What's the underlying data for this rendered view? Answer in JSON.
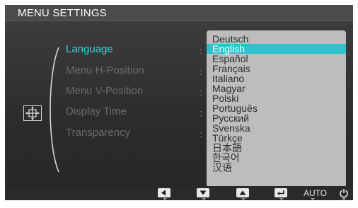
{
  "header": {
    "title": "MENU SETTINGS"
  },
  "menu": {
    "items": [
      {
        "label": "Language"
      },
      {
        "label": "Menu H-Position"
      },
      {
        "label": "Menu V-Position"
      },
      {
        "label": "Display Time"
      },
      {
        "label": "Transparency"
      }
    ],
    "active_index": 0,
    "separator": ":"
  },
  "dropdown": {
    "options": [
      "Deutsch",
      "English",
      "Español",
      "Français",
      "Italiano",
      "Magyar",
      "Polski",
      "Português",
      "Русский",
      "Svenska",
      "Türkçe",
      "日本語",
      "한국어",
      "汉语"
    ],
    "selected": "English"
  },
  "category_icon": "menu-settings-icon",
  "controls": {
    "left": {
      "icon": "left-arrow-icon"
    },
    "down": {
      "icon": "down-arrow-icon"
    },
    "up": {
      "icon": "up-arrow-icon"
    },
    "enter": {
      "icon": "enter-icon"
    },
    "auto": {
      "label": "AUTO"
    },
    "power": {
      "icon": "power-icon"
    }
  },
  "colors": {
    "accent": "#3bd3de",
    "selected_bg": "#2fc2cc",
    "dropdown_bg": "#bdbdbd",
    "inactive_text": "#6a6a6a"
  }
}
